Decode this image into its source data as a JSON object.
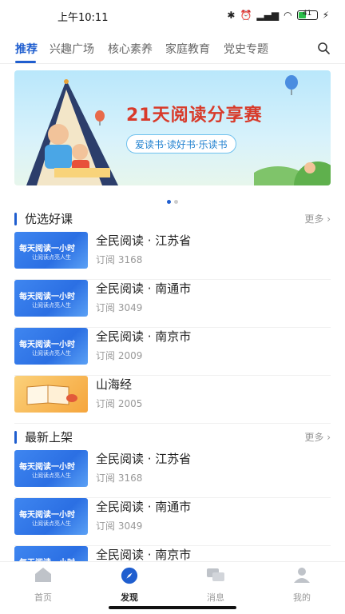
{
  "status": {
    "time": "上午10:11",
    "battery": "41"
  },
  "tabs": [
    {
      "label": "推荐",
      "active": true
    },
    {
      "label": "兴趣广场"
    },
    {
      "label": "核心素养"
    },
    {
      "label": "家庭教育"
    },
    {
      "label": "党史专题"
    }
  ],
  "banner": {
    "title": "21天阅读分享赛",
    "slogan": "爱读书·读好书·乐读书"
  },
  "featured": {
    "title": "优选好课",
    "more": "更多",
    "items": [
      {
        "title": "全民阅读 · 江苏省",
        "subs": "订阅 3168",
        "thumb": "blue"
      },
      {
        "title": "全民阅读 · 南通市",
        "subs": "订阅 3049",
        "thumb": "blue"
      },
      {
        "title": "全民阅读 · 南京市",
        "subs": "订阅 2009",
        "thumb": "blue"
      },
      {
        "title": "山海经",
        "subs": "订阅 2005",
        "thumb": "orange"
      }
    ]
  },
  "latest": {
    "title": "最新上架",
    "more": "更多",
    "items": [
      {
        "title": "全民阅读 · 江苏省",
        "subs": "订阅 3168"
      },
      {
        "title": "全民阅读 · 南通市",
        "subs": "订阅 3049"
      },
      {
        "title": "全民阅读 · 南京市",
        "subs": ""
      }
    ]
  },
  "thumb_text": {
    "line1": "每天阅读一小时",
    "line2": "让阅读点亮人生"
  },
  "bottom_nav": [
    {
      "label": "首页",
      "icon": "home-icon"
    },
    {
      "label": "发现",
      "icon": "discover-icon",
      "active": true
    },
    {
      "label": "消息",
      "icon": "message-icon"
    },
    {
      "label": "我的",
      "icon": "profile-icon"
    }
  ],
  "colors": {
    "accent": "#1f5ecf",
    "banner_title": "#d83a2a"
  }
}
